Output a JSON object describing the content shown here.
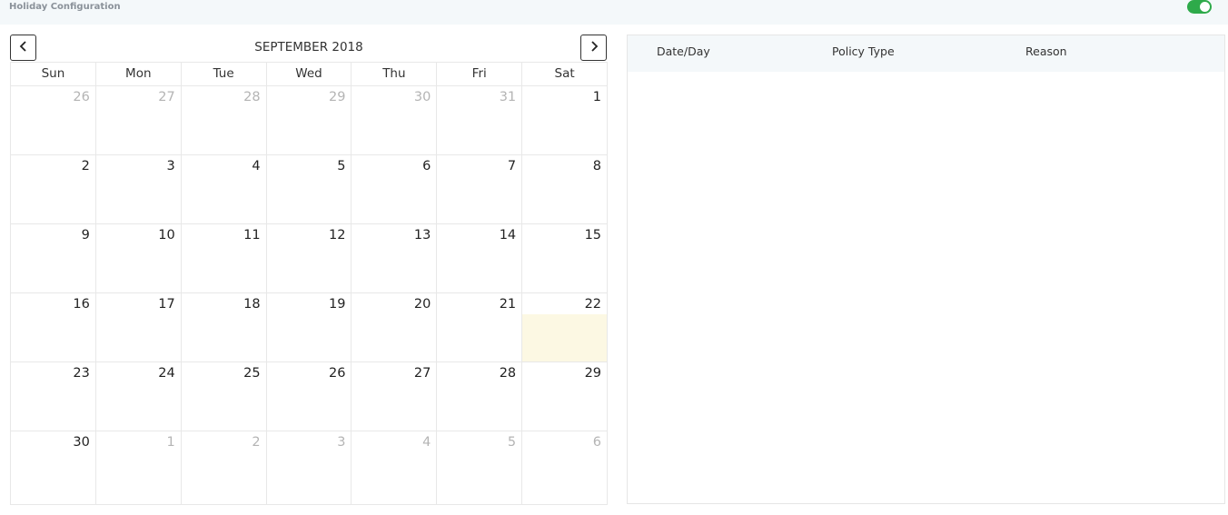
{
  "header": {
    "title": "Holiday Configuration",
    "toggle_on": true,
    "toggle_color": "#2eaa4a"
  },
  "calendar": {
    "month_title": "SEPTEMBER 2018",
    "prev_icon": "chevron-left-icon",
    "next_icon": "chevron-right-icon",
    "weekdays": [
      "Sun",
      "Mon",
      "Tue",
      "Wed",
      "Thu",
      "Fri",
      "Sat"
    ],
    "weeks": [
      [
        {
          "d": "26",
          "o": true
        },
        {
          "d": "27",
          "o": true
        },
        {
          "d": "28",
          "o": true
        },
        {
          "d": "29",
          "o": true
        },
        {
          "d": "30",
          "o": true
        },
        {
          "d": "31",
          "o": true
        },
        {
          "d": "1"
        }
      ],
      [
        {
          "d": "2"
        },
        {
          "d": "3"
        },
        {
          "d": "4"
        },
        {
          "d": "5"
        },
        {
          "d": "6"
        },
        {
          "d": "7"
        },
        {
          "d": "8"
        }
      ],
      [
        {
          "d": "9"
        },
        {
          "d": "10"
        },
        {
          "d": "11"
        },
        {
          "d": "12"
        },
        {
          "d": "13"
        },
        {
          "d": "14"
        },
        {
          "d": "15"
        }
      ],
      [
        {
          "d": "16"
        },
        {
          "d": "17"
        },
        {
          "d": "18"
        },
        {
          "d": "19"
        },
        {
          "d": "20"
        },
        {
          "d": "21"
        },
        {
          "d": "22",
          "t": true
        }
      ],
      [
        {
          "d": "23"
        },
        {
          "d": "24"
        },
        {
          "d": "25"
        },
        {
          "d": "26"
        },
        {
          "d": "27"
        },
        {
          "d": "28"
        },
        {
          "d": "29"
        }
      ],
      [
        {
          "d": "30"
        },
        {
          "d": "1",
          "o": true
        },
        {
          "d": "2",
          "o": true
        },
        {
          "d": "3",
          "o": true
        },
        {
          "d": "4",
          "o": true
        },
        {
          "d": "5",
          "o": true
        },
        {
          "d": "6",
          "o": true
        }
      ]
    ],
    "today_color": "#fcf8e3"
  },
  "holiday_list": {
    "columns": {
      "date": "Date/Day",
      "policy": "Policy Type",
      "reason": "Reason"
    },
    "rows": []
  }
}
